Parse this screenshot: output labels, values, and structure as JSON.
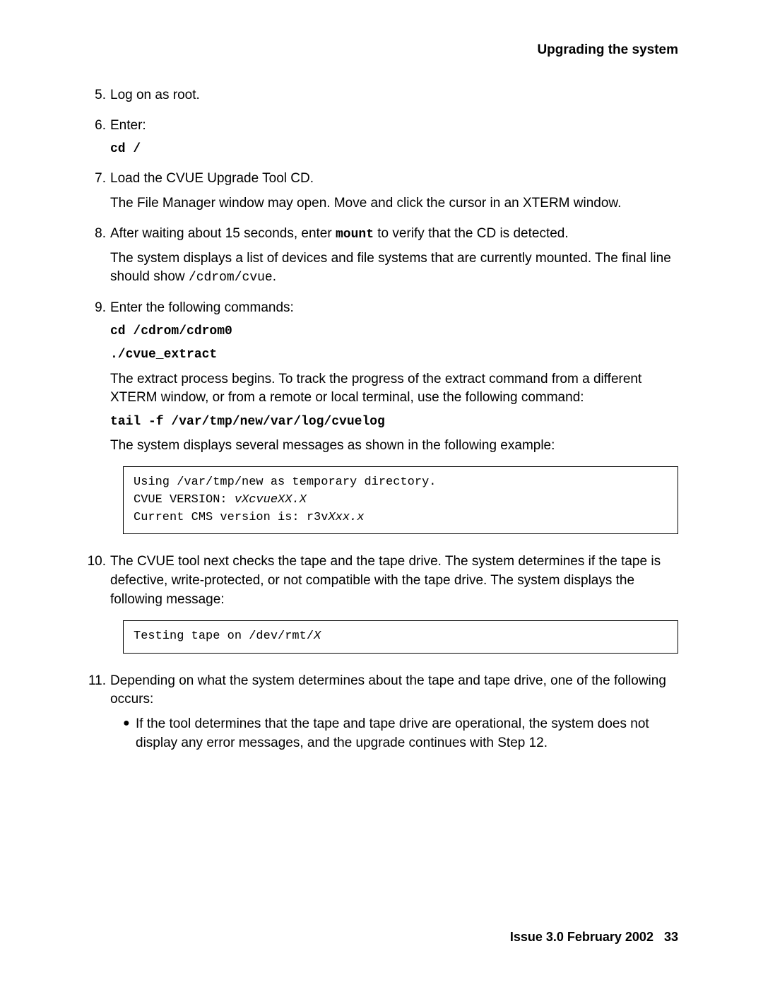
{
  "header": {
    "title": "Upgrading the system"
  },
  "steps": {
    "s5": {
      "num": "5.",
      "text": "Log on as root."
    },
    "s6": {
      "num": "6.",
      "text": "Enter:",
      "cmd": "cd /"
    },
    "s7": {
      "num": "7.",
      "text": "Load the CVUE Upgrade Tool CD.",
      "note": "The File Manager window may open. Move and click the cursor in an XTERM window."
    },
    "s8": {
      "num": "8.",
      "prefix": "After waiting about 15 seconds, enter ",
      "cmd": "mount",
      "suffix": " to verify that the CD is detected.",
      "note_prefix": "The system displays a list of devices and file systems that are currently mounted. The final line should show ",
      "note_mono": "/cdrom/cvue",
      "note_suffix": "."
    },
    "s9": {
      "num": "9.",
      "text": "Enter the following commands:",
      "cmd1": "cd /cdrom/cdrom0",
      "cmd2": "./cvue_extract",
      "para1": "The extract process begins. To track the progress of the extract command from a different XTERM window, or from a remote or local terminal, use the following command:",
      "cmd3": "tail -f /var/tmp/new/var/log/cvuelog",
      "para2": "The system displays several messages as shown in the following example:",
      "box": {
        "line1": "Using /var/tmp/new as temporary directory.",
        "line2a": "CVUE VERSION: ",
        "line2b": "vXcvueXX.X",
        "line3a": "Current CMS version is: r3v",
        "line3b": "Xxx.x"
      }
    },
    "s10": {
      "num": "10.",
      "text": "The CVUE tool next checks the tape and the tape drive. The system determines if the tape is defective, write-protected, or not compatible with the tape drive. The system displays the following message:",
      "box": {
        "line1a": "Testing tape on /dev/rmt/",
        "line1b": "X"
      }
    },
    "s11": {
      "num": "11.",
      "text": "Depending on what the system determines about the tape and tape drive, one of the following occurs:",
      "bullet1": "If the tool determines that the tape and tape drive are operational, the system does not display any error messages, and the upgrade continues with Step 12."
    }
  },
  "footer": {
    "issue": "Issue 3.0   February 2002",
    "page": "33"
  }
}
